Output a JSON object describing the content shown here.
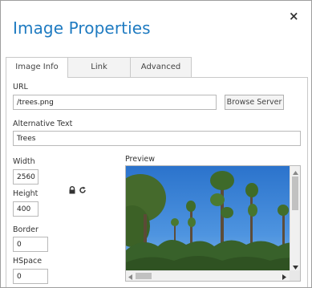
{
  "dialog": {
    "title": "Image Properties",
    "close_glyph": "×"
  },
  "tabs": [
    {
      "label": "Image Info",
      "active": true
    },
    {
      "label": "Link",
      "active": false
    },
    {
      "label": "Advanced",
      "active": false
    }
  ],
  "url": {
    "label": "URL",
    "value": "/trees.png",
    "browse_label": "Browse Server"
  },
  "alt": {
    "label": "Alternative Text",
    "value": "Trees"
  },
  "width": {
    "label": "Width",
    "value": "2560"
  },
  "height": {
    "label": "Height",
    "value": "400"
  },
  "border": {
    "label": "Border",
    "value": "0"
  },
  "hspace": {
    "label": "HSpace",
    "value": "0"
  },
  "icons": {
    "lock": "lock-icon",
    "reset": "reset-size-icon",
    "scroll_up": "arrow-up-icon",
    "scroll_down": "arrow-down-icon",
    "scroll_left": "arrow-left-icon",
    "scroll_right": "arrow-right-icon"
  },
  "preview": {
    "label": "Preview"
  },
  "colors": {
    "title": "#1f7bc1",
    "sky": "#2f7fd6",
    "foliage": "#3f6d2a"
  }
}
